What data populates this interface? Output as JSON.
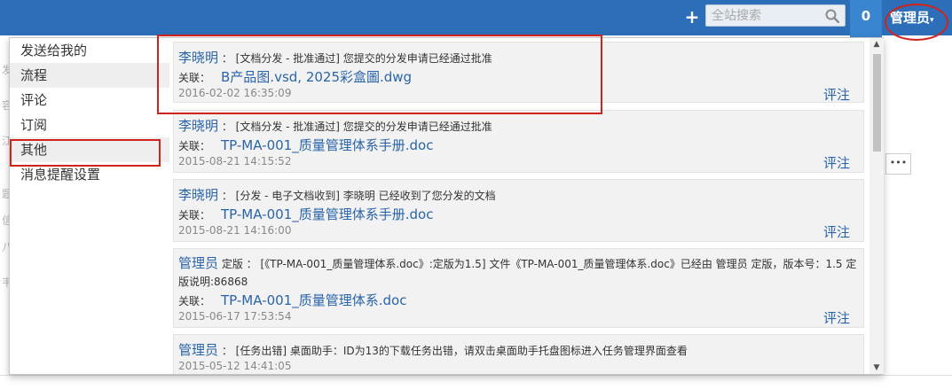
{
  "header": {
    "search_placeholder": "全站搜索",
    "notification_count": "0",
    "user_menu": "管理员"
  },
  "menu": [
    {
      "label": "发送给我的"
    },
    {
      "label": "流程"
    },
    {
      "label": "评论"
    },
    {
      "label": "订阅"
    },
    {
      "label": "其他"
    },
    {
      "label": "消息提醒设置"
    }
  ],
  "notifications": [
    {
      "sender": "李晓明",
      "message": "：  [文档分发 - 批准通过] 您提交的分发申请已经通过批准",
      "related_label": "关联：",
      "files": "B产品图.vsd, 2025彩盒圖.dwg",
      "time": "2016-02-02 16:35:09",
      "comment": "评注"
    },
    {
      "sender": "李晓明",
      "message": "：  [文档分发 - 批准通过] 您提交的分发申请已经通过批准",
      "related_label": "关联：",
      "files": "TP-MA-001_质量管理体系手册.doc",
      "time": "2015-08-21 14:15:52",
      "comment": "评注"
    },
    {
      "sender": "李晓明",
      "message": "：  [分发 - 电子文档收到] 李晓明 已经收到了您分发的文档",
      "related_label": "关联：",
      "files": "TP-MA-001_质量管理体系手册.doc",
      "time": "2015-08-21 14:16:00",
      "comment": "评注"
    },
    {
      "sender": "管理员",
      "message": "定版  ：  [《TP-MA-001_质量管理体系.doc》:定版为1.5] 文件《TP-MA-001_质量管理体系.doc》已经由 管理员 定版，版本号：1.5 定版说明:86868",
      "related_label": "关联：",
      "files": "TP-MA-001_质量管理体系.doc",
      "time": "2015-06-17 17:53:54",
      "comment": "评注"
    },
    {
      "sender": "管理员",
      "message": "：  [任务出错] 桌面助手：ID为13的下载任务出错，请双击桌面助手托盘图标进入任务管理界面查看",
      "time": "2015-05-12 14:41:05"
    }
  ],
  "colors": {
    "header_bg": "#2c6fb8",
    "link": "#2a64a8",
    "annotation_red": "#d0231e"
  }
}
